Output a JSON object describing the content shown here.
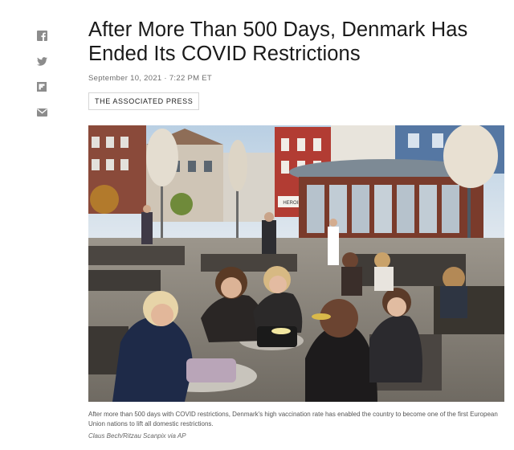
{
  "share": {
    "icons": [
      "facebook-icon",
      "twitter-icon",
      "flipboard-icon",
      "email-icon"
    ]
  },
  "article": {
    "headline": "After More Than 500 Days, Denmark Has Ended Its COVID Restrictions",
    "dateline": "September 10, 2021 · 7:22 PM ET",
    "source": "THE ASSOCIATED PRESS",
    "photo": {
      "storefront_sign": "HEROINES"
    },
    "caption": "After more than 500 days with COVID restrictions, Denmark's high vaccination rate has enabled the country to become one of the first European Union nations to lift all domestic restrictions.",
    "credit": "Claus Bech/Ritzau Scanpix via AP"
  },
  "colors": {
    "share_icon": "#8c8c8c",
    "text": "#1a1a1a",
    "muted": "#6e6e6e"
  }
}
